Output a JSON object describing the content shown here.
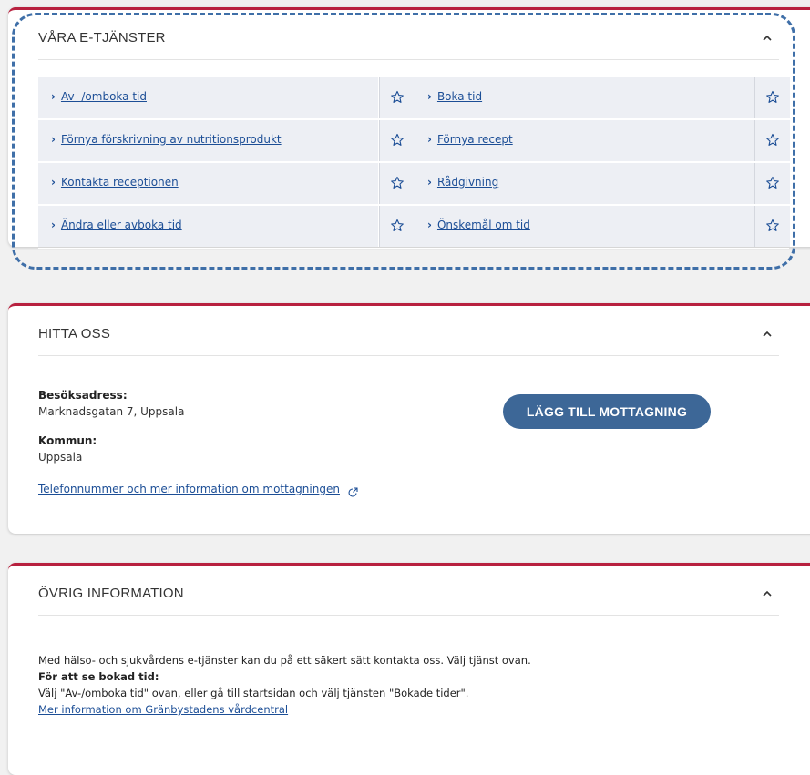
{
  "eservices": {
    "title": "VÅRA E-TJÄNSTER",
    "items": [
      {
        "left": "Av- /omboka tid",
        "right": "Boka tid"
      },
      {
        "left": "Förnya förskrivning av nutritionsprodukt",
        "right": "Förnya recept"
      },
      {
        "left": "Kontakta receptionen",
        "right": "Rådgivning"
      },
      {
        "left": "Ändra eller avboka tid",
        "right": "Önskemål om tid"
      }
    ]
  },
  "find_us": {
    "title": "HITTA OSS",
    "address_label": "Besöksadress:",
    "address_value": "Marknadsgatan 7, Uppsala",
    "municipality_label": "Kommun:",
    "municipality_value": "Uppsala",
    "info_link": "Telefonnummer och mer information om mottagningen",
    "add_button": "LÄGG TILL MOTTAGNING"
  },
  "other_info": {
    "title": "ÖVRIG INFORMATION",
    "line1": "Med hälso- och sjukvårdens e-tjänster kan du på ett säkert sätt kontakta oss. Välj tjänst ovan.",
    "line2": "För att se bokad tid:",
    "line3": "Välj \"Av-/omboka tid\" ovan, eller gå till startsidan och välj tjänsten \"Bokade tider\".",
    "link": "Mer information om Gränbystadens vårdcentral"
  },
  "colors": {
    "accent_border": "#b8213f",
    "link": "#1c4e96",
    "button": "#3d6797",
    "highlight_dash": "#3f6fa8"
  }
}
